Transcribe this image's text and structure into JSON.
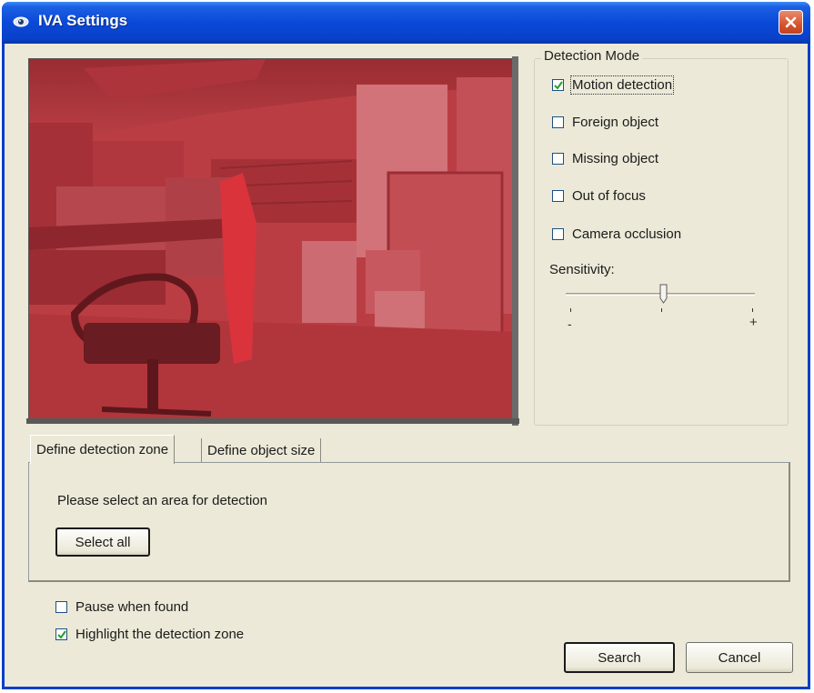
{
  "window": {
    "title": "IVA Settings"
  },
  "detection_mode": {
    "legend": "Detection Mode",
    "options": [
      {
        "label": "Motion detection",
        "checked": true
      },
      {
        "label": "Foreign object",
        "checked": false
      },
      {
        "label": "Missing object",
        "checked": false
      },
      {
        "label": "Out of focus",
        "checked": false
      },
      {
        "label": "Camera occlusion",
        "checked": false
      }
    ],
    "sensitivity": {
      "label": "Sensitivity:",
      "min_label": "-",
      "max_label": "+",
      "level_fraction": 0.5
    }
  },
  "tabs": {
    "items": [
      {
        "label": "Define detection zone",
        "active": true
      },
      {
        "label": "Define object size",
        "active": false
      }
    ],
    "prompt": "Please select an area for detection",
    "select_all_label": "Select all"
  },
  "options": {
    "pause_when_found": {
      "label": "Pause when found",
      "checked": false
    },
    "highlight_zone": {
      "label": "Highlight the detection zone",
      "checked": true
    }
  },
  "buttons": {
    "search_label": "Search",
    "cancel_label": "Cancel"
  },
  "colors": {
    "titlebar": "#0a49d8",
    "window_bg": "#ece9d8",
    "detection_overlay": "#c8323a"
  },
  "icons": {
    "title": "camera-eye-icon",
    "close": "close-icon"
  }
}
